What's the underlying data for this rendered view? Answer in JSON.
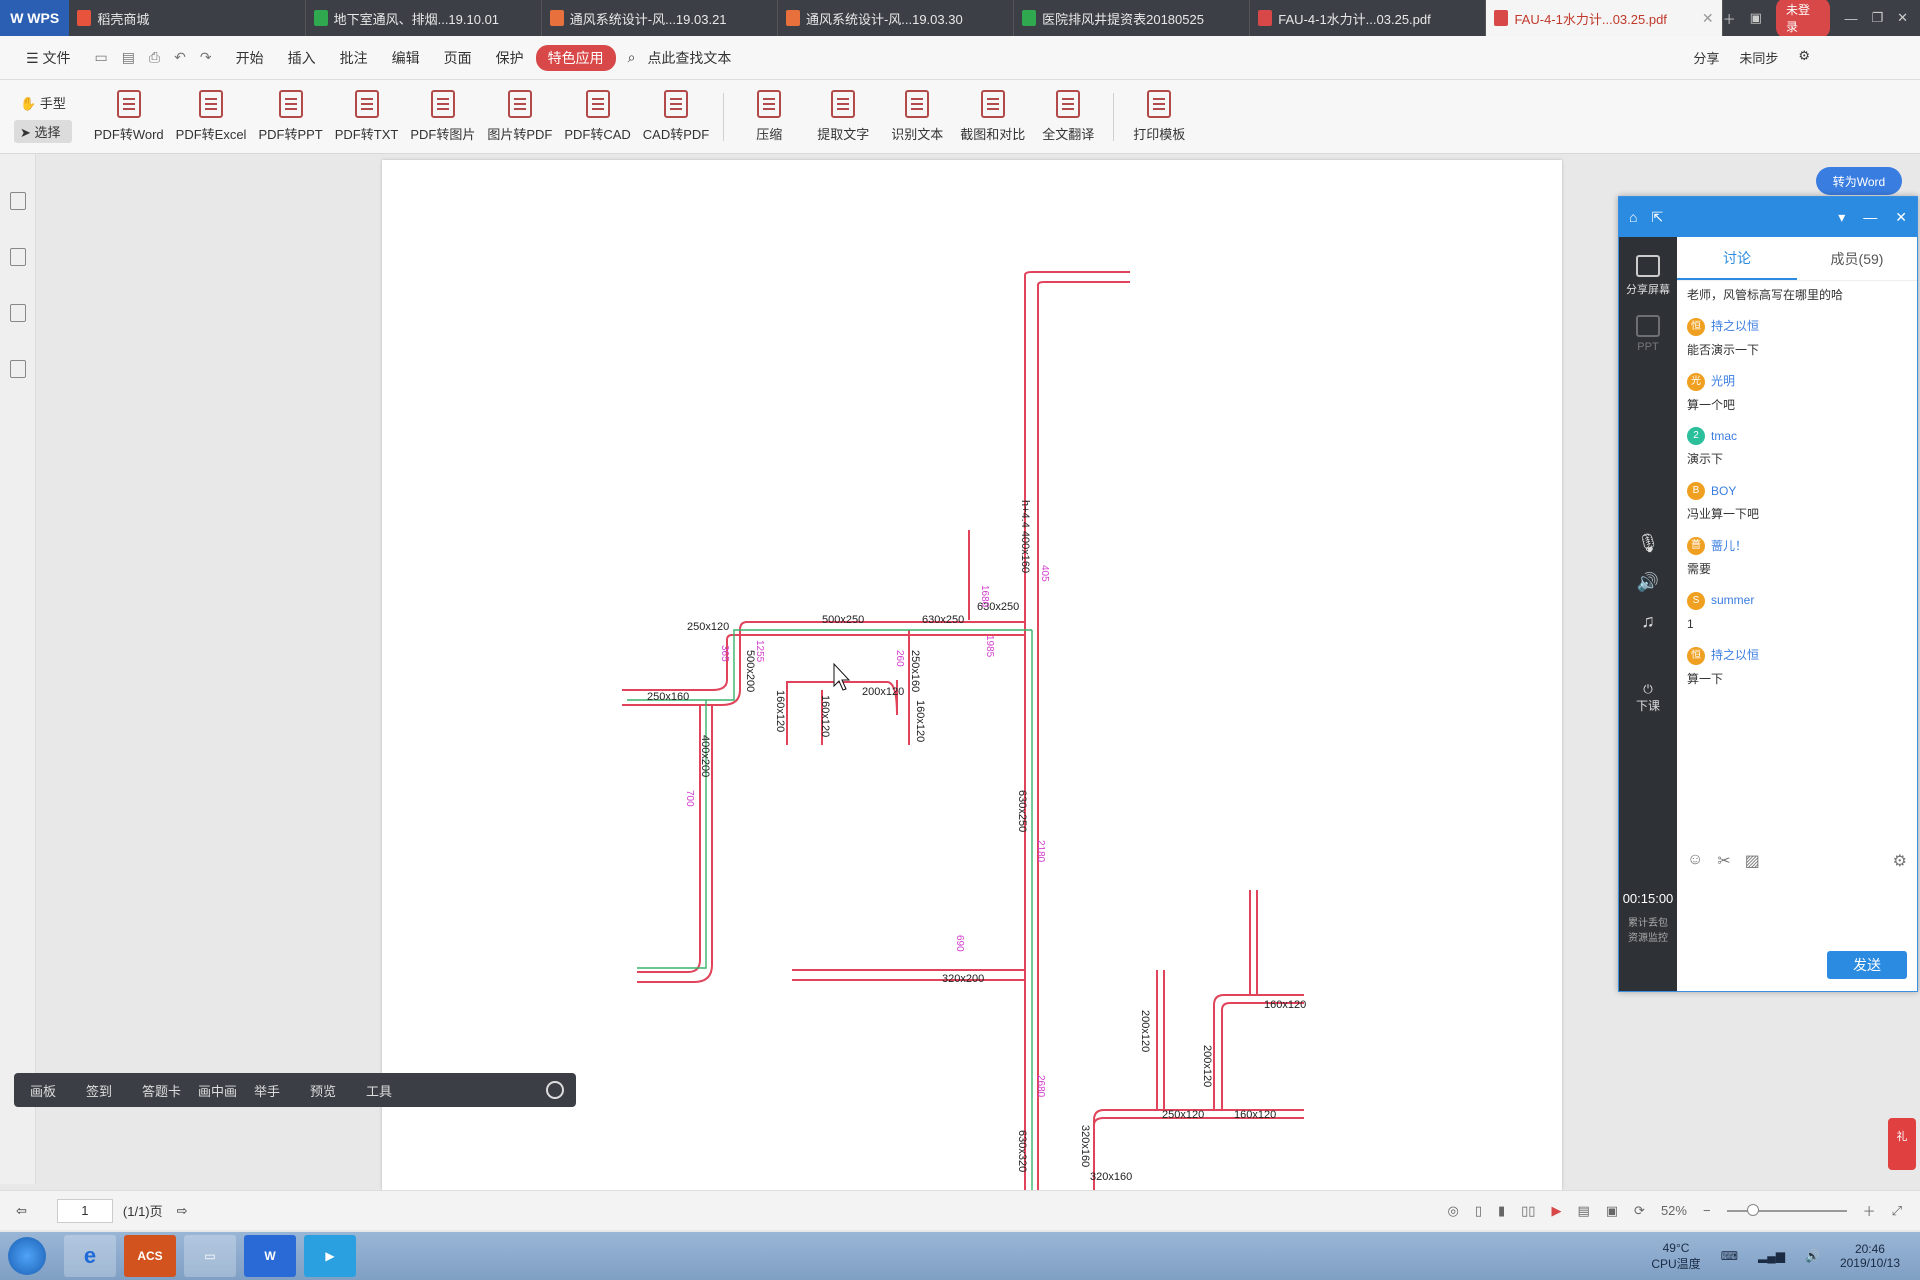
{
  "tabs": [
    {
      "title": "稻壳商城",
      "color": "#e8533d"
    },
    {
      "title": "地下室通风、排烟...19.10.01",
      "color": "#2fa84f"
    },
    {
      "title": "通风系统设计-风...19.03.21",
      "color": "#e8703d"
    },
    {
      "title": "通风系统设计-风...19.03.30",
      "color": "#e8703d"
    },
    {
      "title": "医院排风井提资表20180525",
      "color": "#2fa84f"
    },
    {
      "title": "FAU-4-1水力计...03.25.pdf",
      "color": "#d84848"
    },
    {
      "title": "FAU-4-1水力计...03.25.pdf",
      "color": "#d84848"
    }
  ],
  "app": {
    "logo": "W WPS",
    "login": "未登录"
  },
  "menu": {
    "file": "☰ 文件",
    "items": [
      "开始",
      "插入",
      "批注",
      "编辑",
      "页面",
      "保护"
    ],
    "special": "特色应用",
    "search": "点此查找文本",
    "share": "分享",
    "sync": "未同步"
  },
  "ribbon": {
    "modes": [
      "手型",
      "选择"
    ],
    "buttons": [
      "PDF转Word",
      "PDF转Excel",
      "PDF转PPT",
      "PDF转TXT",
      "PDF转图片",
      "图片转PDF",
      "PDF转CAD",
      "CAD转PDF"
    ],
    "buttons2": [
      "压缩",
      "提取文字",
      "识别文本",
      "截图和对比",
      "全文翻译"
    ],
    "buttons3": [
      "打印模板"
    ]
  },
  "convert_word": "转为Word",
  "classroom": {
    "side": [
      "分享屏幕",
      "PPT"
    ],
    "end": "下课",
    "timer": "00:15:00",
    "stats": "累计丢包",
    "stats2": "资源监控",
    "tab_discuss": "讨论",
    "tab_members": "成员(59)",
    "first": "老师，风管标高写在哪里的哈",
    "messages": [
      {
        "user": "持之以恒",
        "text": "能否演示一下",
        "av": "恒"
      },
      {
        "user": "光明",
        "text": "算一个吧",
        "av": "光"
      },
      {
        "user": "tmac",
        "text": "演示下",
        "av": "2"
      },
      {
        "user": "BOY",
        "text": "冯业算一下吧",
        "av": "B"
      },
      {
        "user": "蔷儿！",
        "text": "需要",
        "av": "蔷"
      },
      {
        "user": "summer",
        "text": "1",
        "av": "S"
      },
      {
        "user": "持之以恒",
        "text": "算一下",
        "av": "恒"
      }
    ],
    "send": "发送"
  },
  "floatbar": [
    "画板",
    "签到",
    "答题卡",
    "画中画",
    "举手",
    "预览",
    "工具"
  ],
  "status": {
    "page": "1",
    "pages": "(1/1)页",
    "zoom": "52%"
  },
  "taskbar": {
    "cpu_temp": "49°C",
    "cpu_label": "CPU温度",
    "time": "20:46",
    "date": "2019/10/13",
    "acs": "ACS"
  },
  "drawing_labels": {
    "duct_500x250": "500x250",
    "duct_630x250": "630x250",
    "duct_630x250b": "630x250",
    "duct_250x120": "250x120",
    "duct_250x160": "250x160",
    "duct_500x200": "500x200",
    "duct_400x200": "400x200",
    "duct_200x120": "200x120",
    "duct_160x120": "160x120",
    "duct_160x120b": "160x120",
    "duct_250x160b": "250x160",
    "duct_160x120c": "160x120",
    "duct_630x250_v": "630x250",
    "duct_630x320": "630x320",
    "duct_320x200": "320x200",
    "duct_250x120b": "250x120",
    "duct_160x120d": "160x120",
    "duct_160x120e": "160x120",
    "duct_200x120b": "200x120",
    "duct_200x120c": "200x120",
    "duct_320x160": "320x160",
    "duct_320x160b": "320x160",
    "duct_main_v": "h+4.4 400x160",
    "dim_1255": "1255",
    "dim_1985": "1985",
    "dim_365": "365",
    "dim_260": "260",
    "dim_700": "700",
    "dim_690": "690",
    "dim_2180": "2180",
    "dim_2680": "2680",
    "dim_1680": "1680",
    "dim_405": "405"
  }
}
